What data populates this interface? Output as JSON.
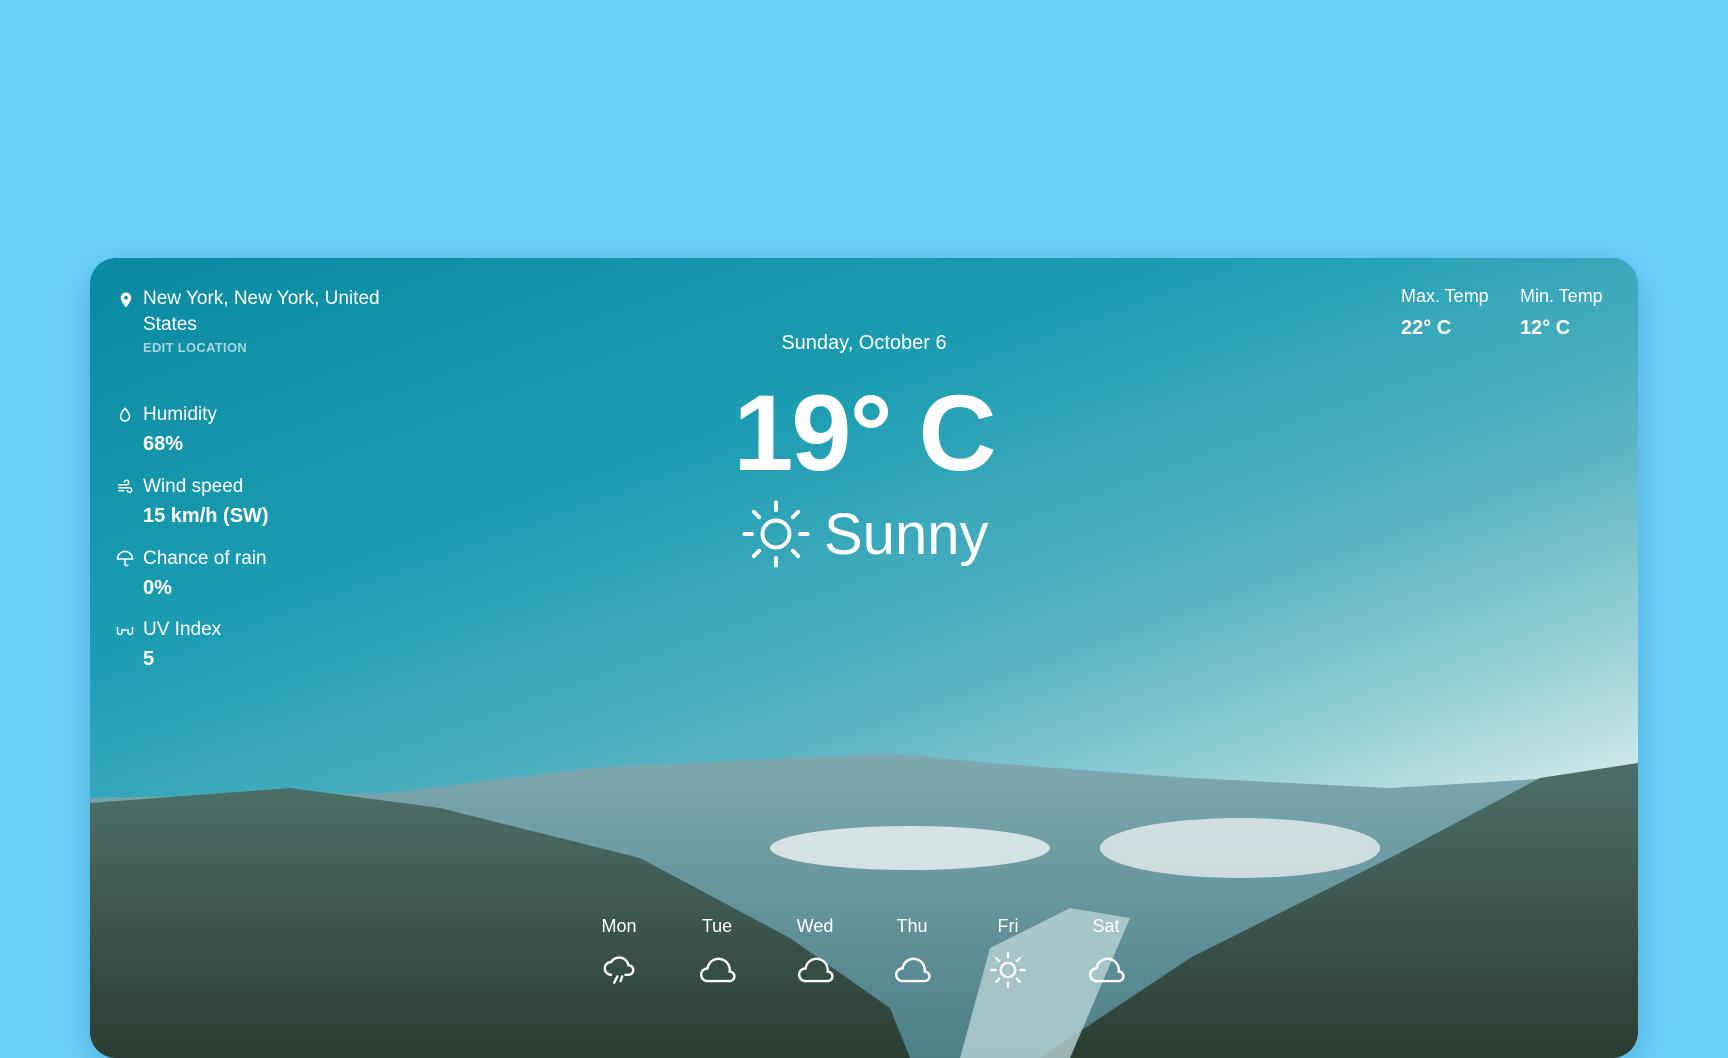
{
  "location": {
    "name": "New York, New York, United States",
    "edit_label": "EDIT LOCATION"
  },
  "stats": [
    {
      "label": "Humidity",
      "value": "68%",
      "icon": "droplet-icon"
    },
    {
      "label": "Wind speed",
      "value": "15 km/h (SW)",
      "icon": "wind-icon"
    },
    {
      "label": "Chance of rain",
      "value": "0%",
      "icon": "umbrella-icon"
    },
    {
      "label": "UV Index",
      "value": "5",
      "icon": "sunglasses-icon"
    }
  ],
  "current": {
    "date": "Sunday, October 6",
    "temperature": "19° C",
    "condition": "Sunny",
    "icon": "sun-icon"
  },
  "range": {
    "max_label": "Max. Temp",
    "max_value": "22° C",
    "min_label": "Min. Temp",
    "min_value": "12° C"
  },
  "forecast": [
    {
      "day": "Mon",
      "icon": "rain-cloud-icon"
    },
    {
      "day": "Tue",
      "icon": "cloud-icon"
    },
    {
      "day": "Wed",
      "icon": "cloud-icon"
    },
    {
      "day": "Thu",
      "icon": "cloud-icon"
    },
    {
      "day": "Fri",
      "icon": "sun-icon"
    },
    {
      "day": "Sat",
      "icon": "cloud-icon"
    }
  ]
}
